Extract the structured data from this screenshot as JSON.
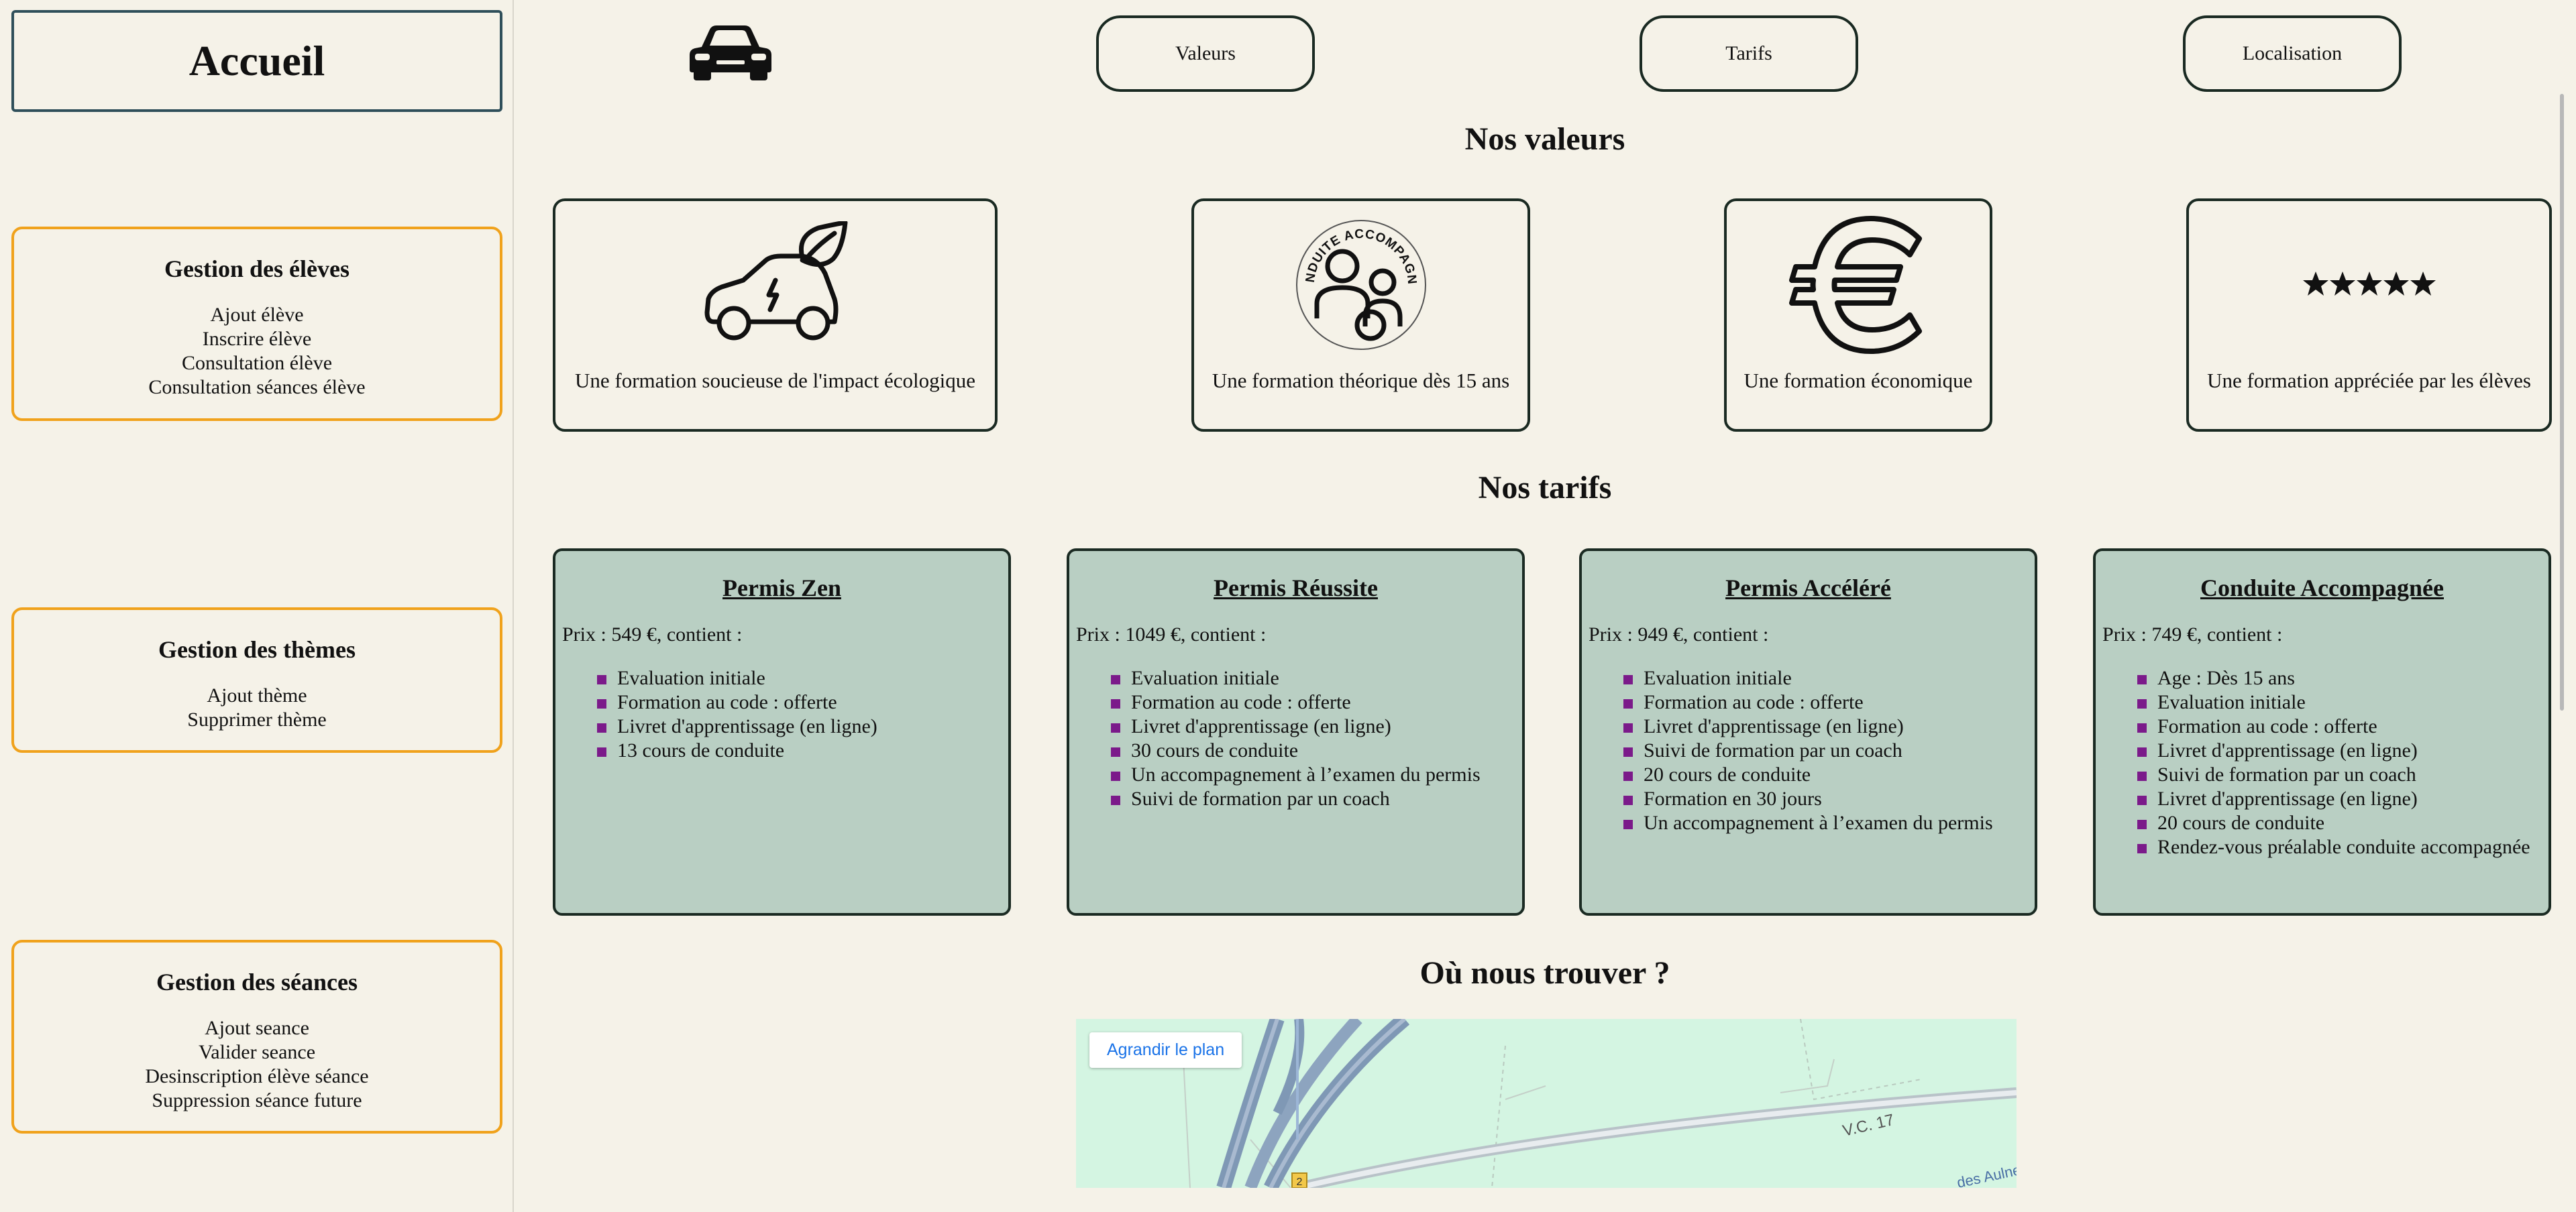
{
  "sidebar": {
    "home": "Accueil",
    "eleves": {
      "title": "Gestion des élèves",
      "links": [
        "Ajout élève",
        "Inscrire élève",
        "Consultation élève",
        "Consultation séances élève"
      ]
    },
    "themes": {
      "title": "Gestion des thèmes",
      "links": [
        "Ajout thème",
        "Supprimer thème"
      ]
    },
    "seances": {
      "title": "Gestion des séances",
      "links": [
        "Ajout seance",
        "Valider seance",
        "Desinscription élève séance",
        "Suppression séance future"
      ]
    }
  },
  "nav": {
    "logo_icon": "car-icon",
    "valeurs": "Valeurs",
    "tarifs": "Tarifs",
    "localisation": "Localisation"
  },
  "values_section": {
    "title": "Nos valeurs",
    "items": [
      {
        "icon": "eco-car-icon",
        "text": "Une formation soucieuse de l'impact écologique"
      },
      {
        "icon": "supervised-driving-badge",
        "badge_text": "CONDUITE ACCOMPAGNÉE",
        "text": "Une formation théorique dès 15 ans"
      },
      {
        "icon": "euro-icon",
        "text": "Une formation économique"
      },
      {
        "icon": "five-stars-icon",
        "text": "Une formation appréciée par les élèves"
      }
    ]
  },
  "prices_section": {
    "title": "Nos tarifs",
    "bullet_color": "#7b1a8a",
    "card_color": "#b9cfc3",
    "plans": [
      {
        "name": "Permis Zen",
        "price": "Prix : 549 €, contient :",
        "features": [
          "Evaluation initiale",
          "Formation au code : offerte",
          "Livret d'apprentissage (en ligne)",
          "13 cours de conduite"
        ]
      },
      {
        "name": "Permis Réussite",
        "price": "Prix : 1049 €, contient :",
        "features": [
          "Evaluation initiale",
          "Formation au code : offerte",
          "Livret d'apprentissage (en ligne)",
          "30 cours de conduite",
          "Un accompagnement à l’examen du permis",
          "Suivi de formation par un coach"
        ]
      },
      {
        "name": "Permis Accéléré",
        "price": "Prix : 949 €, contient :",
        "features": [
          "Evaluation initiale",
          "Formation au code : offerte",
          "Livret d'apprentissage (en ligne)",
          "Suivi de formation par un coach",
          "20 cours de conduite",
          "Formation en 30 jours",
          "Un accompagnement à l’examen du permis"
        ]
      },
      {
        "name": "Conduite Accompagnée",
        "price": "Prix : 749 €, contient :",
        "features": [
          "Age : Dès 15 ans",
          "Evaluation initiale",
          "Formation au code : offerte",
          "Livret d'apprentissage (en ligne)",
          "Suivi de formation par un coach",
          "Livret d'apprentissage (en ligne)",
          "20 cours de conduite",
          "Rendez-vous préalable conduite accompagnée"
        ]
      }
    ]
  },
  "map_section": {
    "title": "Où nous trouver ?",
    "enlarge_button": "Agrandir le plan",
    "road_label": "V.C. 17",
    "road_number": "2",
    "partial_label": "des Aulne"
  }
}
